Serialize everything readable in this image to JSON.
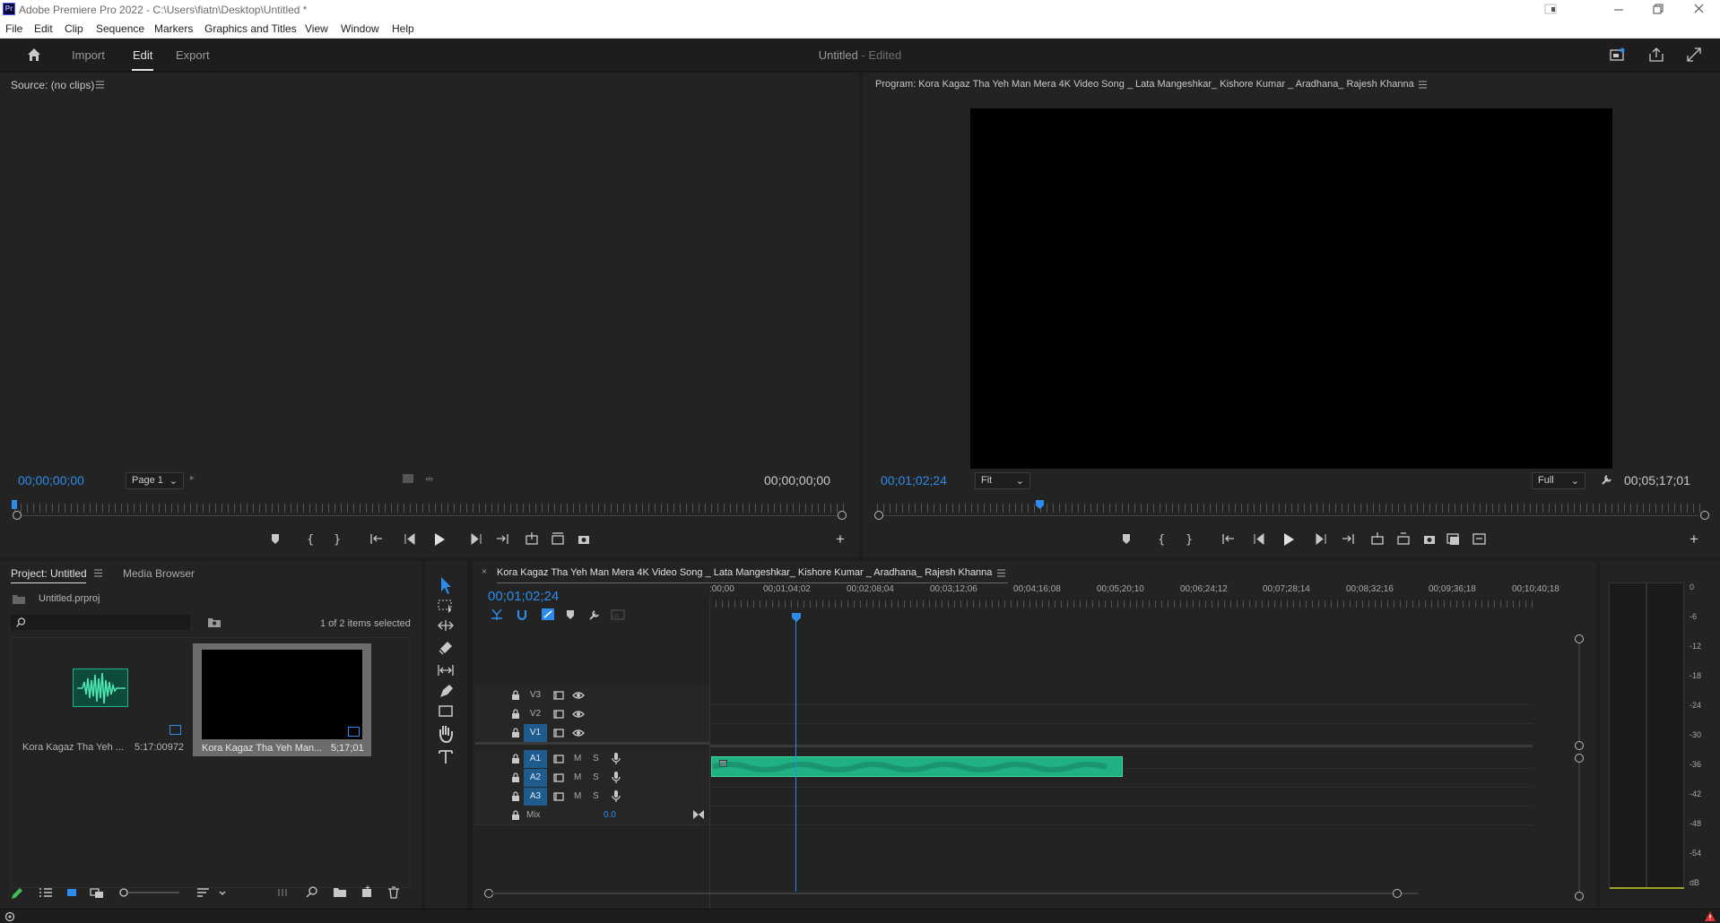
{
  "app": {
    "window_title": "Adobe Premiere Pro 2022 - C:\\Users\\fiatn\\Desktop\\Untitled *",
    "pr_logo": "Pr"
  },
  "menu": [
    "File",
    "Edit",
    "Clip",
    "Sequence",
    "Markers",
    "Graphics and Titles",
    "View",
    "Window",
    "Help"
  ],
  "workspace": {
    "tabs": [
      "Import",
      "Edit",
      "Export"
    ],
    "active_tab": "Edit",
    "doc_title": "Untitled",
    "doc_status": "- Edited"
  },
  "source": {
    "title": "Source: (no clips)",
    "timecode_left": "00;00;00;00",
    "page_select": "Page 1",
    "timecode_right": "00;00;00;00"
  },
  "program": {
    "title": "Program: Kora Kagaz Tha Yeh Man Mera 4K Video Song _ Lata Mangeshkar_ Kishore Kumar _ Aradhana_ Rajesh Khanna",
    "timecode_left": "00;01;02;24",
    "zoom": "Fit",
    "resolution": "Full",
    "duration": "00;05;17;01",
    "playhead_fraction": 0.195
  },
  "project": {
    "tabs": [
      "Project: Untitled",
      "Media Browser"
    ],
    "file_name": "Untitled.prproj",
    "selection_status": "1 of 2 items selected",
    "search_placeholder": "",
    "items": [
      {
        "name": "Kora Kagaz Tha Yeh ...",
        "duration": "5:17:00972",
        "type": "audio",
        "selected": false
      },
      {
        "name": "Kora Kagaz Tha Yeh Man...",
        "duration": "5;17;01",
        "type": "video",
        "selected": true
      }
    ]
  },
  "timeline": {
    "sequence_name": "Kora Kagaz Tha Yeh Man Mera 4K Video Song _ Lata Mangeshkar_ Kishore Kumar _ Aradhana_ Rajesh Khanna",
    "timecode": "00;01;02;24",
    "ruler_labels": [
      ":00;00",
      "00;01;04;02",
      "00;02;08;04",
      "00;03;12;06",
      "00;04;16;08",
      "00;05;20;10",
      "00;06;24;12",
      "00;07;28;14",
      "00;08;32;16",
      "00;09;36;18",
      "00;10;40;18"
    ],
    "video_tracks": [
      "V3",
      "V2",
      "V1"
    ],
    "audio_tracks": [
      "A1",
      "A2",
      "A3"
    ],
    "active_video": "V1",
    "active_audio": [
      "A1",
      "A2",
      "A3"
    ],
    "mute_label": "M",
    "solo_label": "S",
    "mix_label": "Mix",
    "mix_value": "0.0"
  },
  "meter": {
    "scale": [
      "0",
      "-6",
      "-12",
      "-18",
      "-24",
      "-30",
      "-36",
      "-42",
      "-48",
      "-54",
      "dB"
    ]
  },
  "colors": {
    "accent_blue": "#2d8ceb",
    "audio_clip": "#1fb084",
    "track_active": "#1f5b8d"
  }
}
